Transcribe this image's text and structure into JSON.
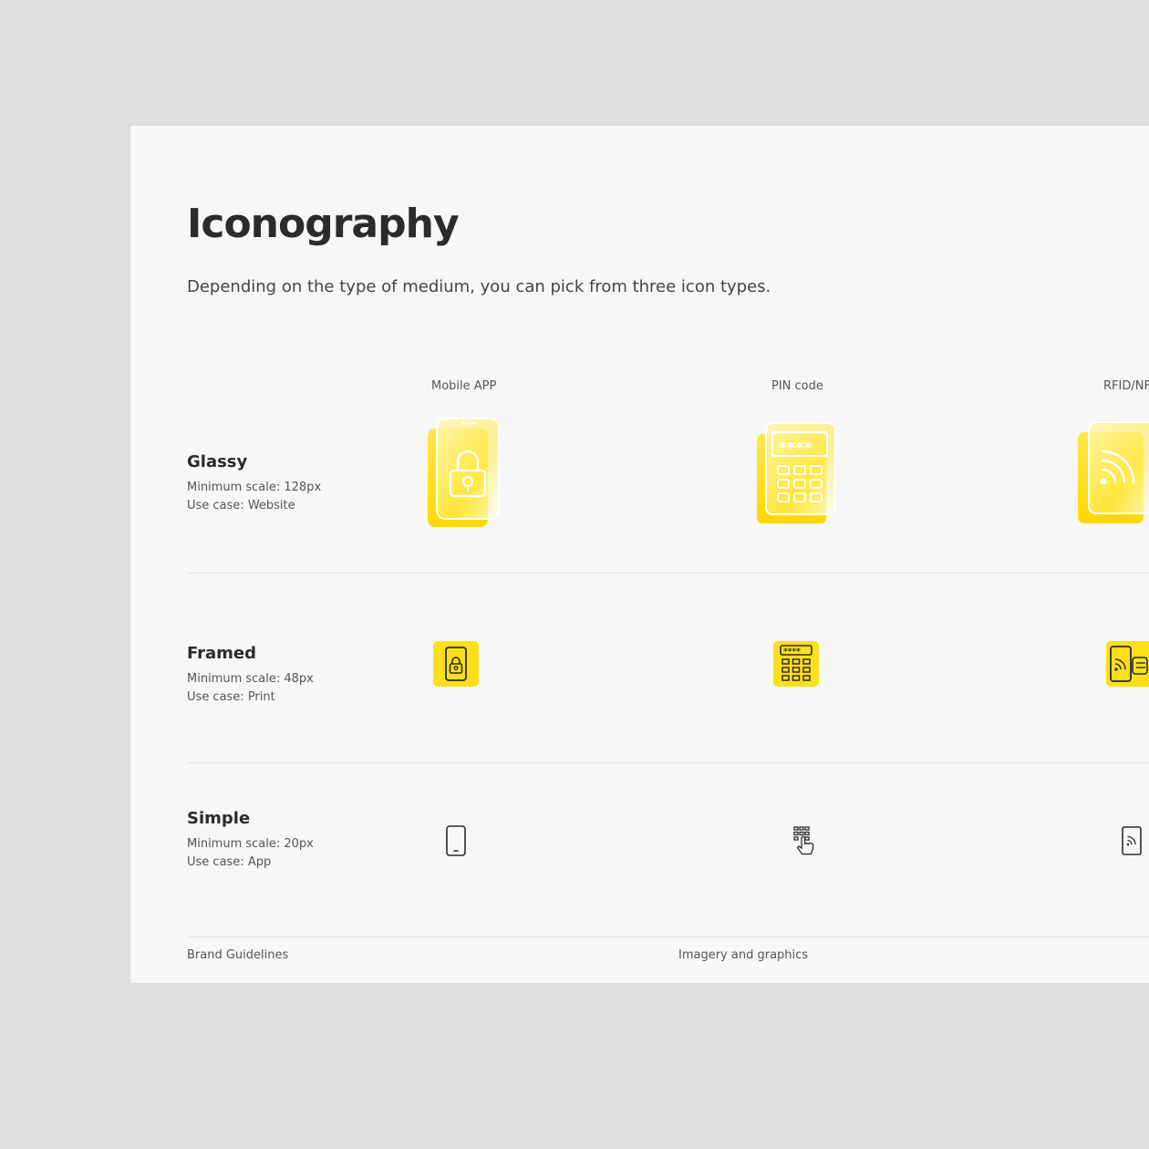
{
  "header": {
    "title": "Iconography",
    "subtitle": "Depending on the type of medium, you can pick from three icon types."
  },
  "columns": [
    {
      "label": "Mobile APP",
      "icon": "mobile-lock-icon"
    },
    {
      "label": "PIN code",
      "icon": "pin-keypad-icon"
    },
    {
      "label": "RFID/NF",
      "icon": "rfid-nfc-icon"
    }
  ],
  "rows": [
    {
      "name": "Glassy",
      "scale": "Minimum scale: 128px",
      "use_case": "Use case: Website"
    },
    {
      "name": "Framed",
      "scale": "Minimum scale: 48px",
      "use_case": "Use case: Print"
    },
    {
      "name": "Simple",
      "scale": "Minimum scale: 20px",
      "use_case": "Use case: App"
    }
  ],
  "footer": {
    "left": "Brand Guidelines",
    "center": "Imagery and graphics"
  },
  "colors": {
    "accent": "#ffde1a",
    "background": "#dedede",
    "page": "#f7f7f7",
    "text": "#2e2e2e"
  }
}
